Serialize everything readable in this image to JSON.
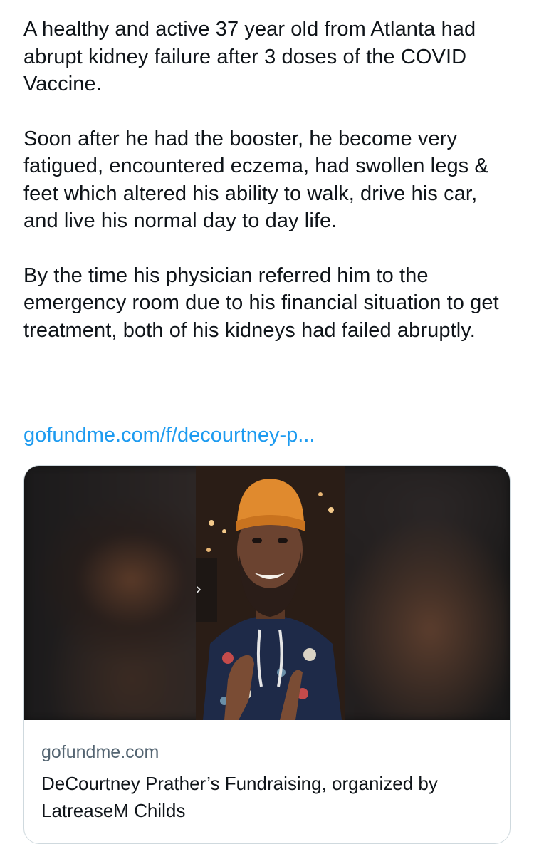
{
  "tweet": {
    "paragraphs": [
      "A healthy and active 37 year old from Atlanta had abrupt kidney failure after 3 doses of the COVID Vaccine.",
      "Soon after he had the booster, he become very fatigued, encountered eczema, had swollen legs & feet which altered his ability to walk, drive his car, and live his normal day to day life.",
      "By the time his physician referred him to the emergency room due to his financial situation to get treatment, both of his kidneys had failed abruptly."
    ],
    "link_text": "gofundme.com/f/decourtney-p..."
  },
  "card": {
    "image_icon": "chevron-right-icon",
    "arrow_glyph": "›",
    "domain": "gofundme.com",
    "title": "DeCourtney Prather’s Fundraising, organized by LatreaseM Childs"
  },
  "colors": {
    "link": "#1d9bf0",
    "text": "#0f1419",
    "secondary_text": "#536471",
    "card_border": "#cfd9de"
  }
}
